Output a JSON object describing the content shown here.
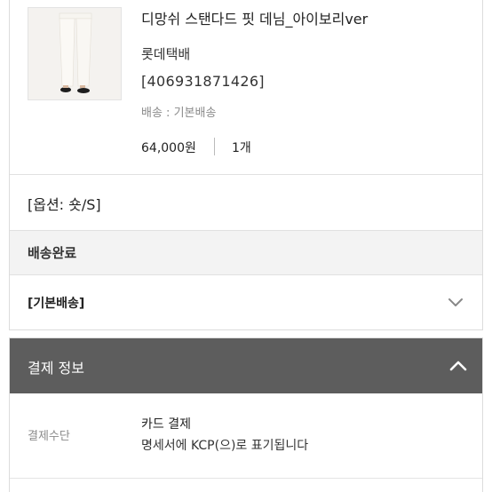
{
  "order_item": {
    "product_name": "디망쉬 스탠다드 핏 데님_아이보리ver",
    "courier": "롯데택배",
    "tracking_number": "[406931871426]",
    "shipping_label": "배송 : 기본배송",
    "price": "64,000원",
    "quantity": "1개",
    "option": "[옵션: 숏/S]",
    "status": "배송완료",
    "shipping_type": "[기본배송]",
    "shipping_type_icon": "chevron-down-icon"
  },
  "payment": {
    "section_title": "결제 정보",
    "collapse_icon": "chevron-up-icon",
    "method_label": "결제수단",
    "method_value": "카드 결제",
    "method_note": "명세서에 KCP(으)로 표기됩니다"
  },
  "colors": {
    "payment_header_bg": "#5d5d5d",
    "status_row_bg": "#f3f3f3",
    "muted_text": "#8a8a8a"
  }
}
